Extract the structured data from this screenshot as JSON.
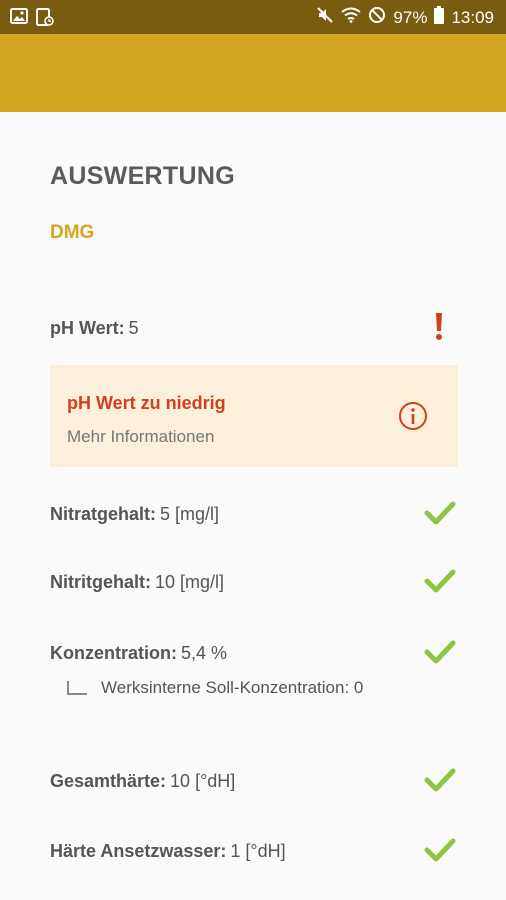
{
  "status_bar": {
    "battery": "97%",
    "time": "13:09"
  },
  "page": {
    "title": "AUSWERTUNG",
    "subtitle": "DMG"
  },
  "measurements": [
    {
      "label": "pH Wert:",
      "value": "5",
      "status": "warning"
    },
    {
      "label": "Nitratgehalt:",
      "value": "5 [mg/l]",
      "status": "ok"
    },
    {
      "label": "Nitritgehalt:",
      "value": "10 [mg/l]",
      "status": "ok"
    },
    {
      "label": "Konzentration:",
      "value": "5,4 %",
      "status": "ok"
    },
    {
      "label": "Gesamthärte:",
      "value": "10 [°dH]",
      "status": "ok"
    },
    {
      "label": "Härte Ansetzwasser:",
      "value": "1 [°dH]",
      "status": "ok"
    }
  ],
  "alert": {
    "title": "pH Wert zu niedrig",
    "link": "Mehr Informationen",
    "icon": "info-icon"
  },
  "sub_item": {
    "text": "Werksinterne Soll-Konzentration: 0"
  },
  "colors": {
    "status_bar": "#7a5c10",
    "app_bar": "#d4a520",
    "accent": "#d4a520",
    "warning": "#d0401c",
    "ok": "#8cc63f",
    "alert_bg": "#fcefdc"
  }
}
